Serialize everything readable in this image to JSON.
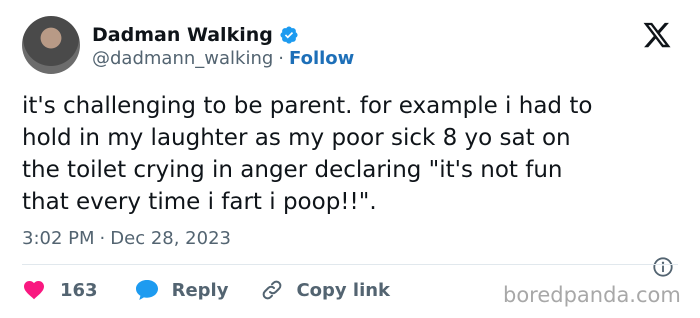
{
  "author": {
    "name": "Dadman Walking",
    "handle": "@dadmann_walking",
    "separator": "·",
    "follow_label": "Follow"
  },
  "tweet": {
    "text": "it's challenging to be parent. for example i had to\nhold in my laughter as my poor sick 8 yo sat on\nthe toilet crying in anger declaring \"it's not fun\nthat every time i fart i poop!!\".",
    "time": "3:02 PM",
    "separator": "·",
    "date": "Dec 28, 2023"
  },
  "actions": {
    "likes": "163",
    "reply_label": "Reply",
    "copy_label": "Copy link"
  },
  "watermark": "boredpanda.com",
  "colors": {
    "accent": "#1d9bf0",
    "follow": "#1d6fb8",
    "like": "#f91880",
    "muted": "#536471"
  },
  "icons": [
    "verified-badge-icon",
    "x-logo-icon",
    "info-icon",
    "heart-icon",
    "reply-bubble-icon",
    "link-icon"
  ]
}
